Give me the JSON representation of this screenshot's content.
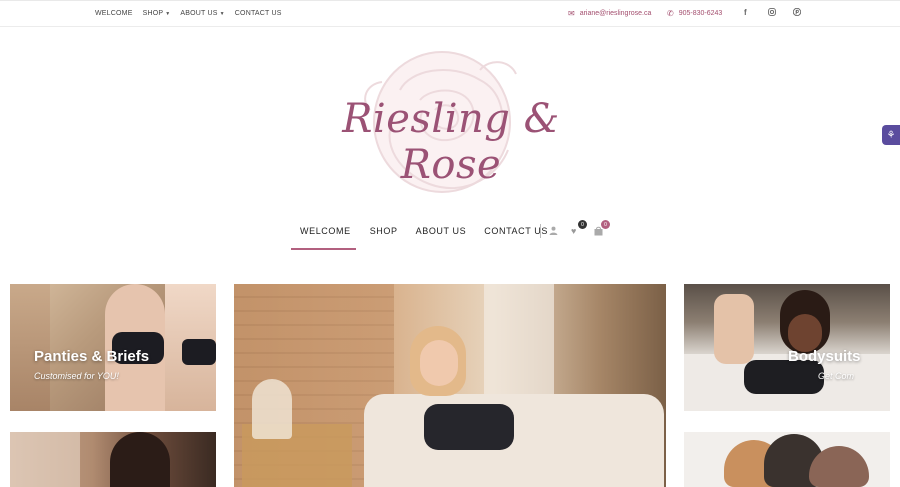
{
  "topbar": {
    "nav": [
      {
        "label": "WELCOME"
      },
      {
        "label": "SHOP",
        "has_dropdown": true
      },
      {
        "label": "ABOUT US",
        "has_dropdown": true
      },
      {
        "label": "CONTACT US"
      }
    ],
    "email": "ariane@rieslingrose.ca",
    "phone": "905-830-6243",
    "social": [
      "facebook-icon",
      "instagram-icon",
      "pinterest-icon"
    ]
  },
  "logo": {
    "text": "Riesling & Rose"
  },
  "main_nav": {
    "items": [
      {
        "label": "WELCOME",
        "active": true
      },
      {
        "label": "SHOP"
      },
      {
        "label": "ABOUT US"
      },
      {
        "label": "CONTACT US"
      }
    ],
    "wishlist_count": "0",
    "cart_count": "0"
  },
  "tiles": {
    "panties": {
      "title": "Panties & Briefs",
      "subtitle": "Customised for YOU!"
    },
    "bodysuits": {
      "title": "Bodysuits",
      "subtitle": "Get Com"
    }
  },
  "colors": {
    "accent": "#b2607f",
    "logo": "#9b5275",
    "dark": "#222222"
  }
}
